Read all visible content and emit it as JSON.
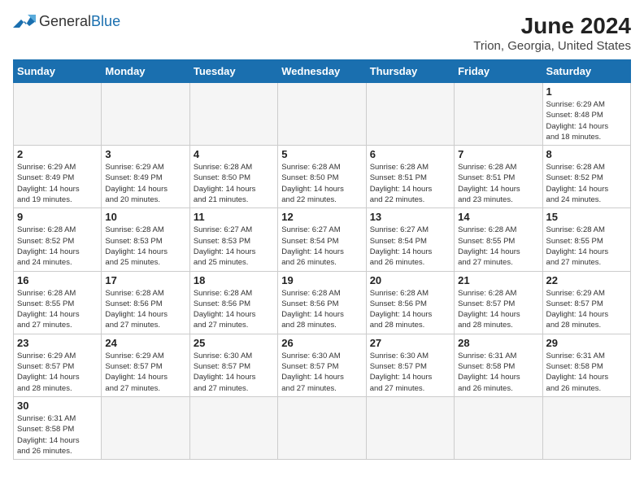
{
  "logo": {
    "text_general": "General",
    "text_blue": "Blue"
  },
  "title": "June 2024",
  "subtitle": "Trion, Georgia, United States",
  "days_of_week": [
    "Sunday",
    "Monday",
    "Tuesday",
    "Wednesday",
    "Thursday",
    "Friday",
    "Saturday"
  ],
  "weeks": [
    [
      {
        "day": "",
        "info": ""
      },
      {
        "day": "",
        "info": ""
      },
      {
        "day": "",
        "info": ""
      },
      {
        "day": "",
        "info": ""
      },
      {
        "day": "",
        "info": ""
      },
      {
        "day": "",
        "info": ""
      },
      {
        "day": "1",
        "info": "Sunrise: 6:29 AM\nSunset: 8:48 PM\nDaylight: 14 hours\nand 18 minutes."
      }
    ],
    [
      {
        "day": "2",
        "info": "Sunrise: 6:29 AM\nSunset: 8:49 PM\nDaylight: 14 hours\nand 19 minutes."
      },
      {
        "day": "3",
        "info": "Sunrise: 6:29 AM\nSunset: 8:49 PM\nDaylight: 14 hours\nand 20 minutes."
      },
      {
        "day": "4",
        "info": "Sunrise: 6:28 AM\nSunset: 8:50 PM\nDaylight: 14 hours\nand 21 minutes."
      },
      {
        "day": "5",
        "info": "Sunrise: 6:28 AM\nSunset: 8:50 PM\nDaylight: 14 hours\nand 22 minutes."
      },
      {
        "day": "6",
        "info": "Sunrise: 6:28 AM\nSunset: 8:51 PM\nDaylight: 14 hours\nand 22 minutes."
      },
      {
        "day": "7",
        "info": "Sunrise: 6:28 AM\nSunset: 8:51 PM\nDaylight: 14 hours\nand 23 minutes."
      },
      {
        "day": "8",
        "info": "Sunrise: 6:28 AM\nSunset: 8:52 PM\nDaylight: 14 hours\nand 24 minutes."
      }
    ],
    [
      {
        "day": "9",
        "info": "Sunrise: 6:28 AM\nSunset: 8:52 PM\nDaylight: 14 hours\nand 24 minutes."
      },
      {
        "day": "10",
        "info": "Sunrise: 6:28 AM\nSunset: 8:53 PM\nDaylight: 14 hours\nand 25 minutes."
      },
      {
        "day": "11",
        "info": "Sunrise: 6:27 AM\nSunset: 8:53 PM\nDaylight: 14 hours\nand 25 minutes."
      },
      {
        "day": "12",
        "info": "Sunrise: 6:27 AM\nSunset: 8:54 PM\nDaylight: 14 hours\nand 26 minutes."
      },
      {
        "day": "13",
        "info": "Sunrise: 6:27 AM\nSunset: 8:54 PM\nDaylight: 14 hours\nand 26 minutes."
      },
      {
        "day": "14",
        "info": "Sunrise: 6:28 AM\nSunset: 8:55 PM\nDaylight: 14 hours\nand 27 minutes."
      },
      {
        "day": "15",
        "info": "Sunrise: 6:28 AM\nSunset: 8:55 PM\nDaylight: 14 hours\nand 27 minutes."
      }
    ],
    [
      {
        "day": "16",
        "info": "Sunrise: 6:28 AM\nSunset: 8:55 PM\nDaylight: 14 hours\nand 27 minutes."
      },
      {
        "day": "17",
        "info": "Sunrise: 6:28 AM\nSunset: 8:56 PM\nDaylight: 14 hours\nand 27 minutes."
      },
      {
        "day": "18",
        "info": "Sunrise: 6:28 AM\nSunset: 8:56 PM\nDaylight: 14 hours\nand 27 minutes."
      },
      {
        "day": "19",
        "info": "Sunrise: 6:28 AM\nSunset: 8:56 PM\nDaylight: 14 hours\nand 28 minutes."
      },
      {
        "day": "20",
        "info": "Sunrise: 6:28 AM\nSunset: 8:56 PM\nDaylight: 14 hours\nand 28 minutes."
      },
      {
        "day": "21",
        "info": "Sunrise: 6:28 AM\nSunset: 8:57 PM\nDaylight: 14 hours\nand 28 minutes."
      },
      {
        "day": "22",
        "info": "Sunrise: 6:29 AM\nSunset: 8:57 PM\nDaylight: 14 hours\nand 28 minutes."
      }
    ],
    [
      {
        "day": "23",
        "info": "Sunrise: 6:29 AM\nSunset: 8:57 PM\nDaylight: 14 hours\nand 28 minutes."
      },
      {
        "day": "24",
        "info": "Sunrise: 6:29 AM\nSunset: 8:57 PM\nDaylight: 14 hours\nand 27 minutes."
      },
      {
        "day": "25",
        "info": "Sunrise: 6:30 AM\nSunset: 8:57 PM\nDaylight: 14 hours\nand 27 minutes."
      },
      {
        "day": "26",
        "info": "Sunrise: 6:30 AM\nSunset: 8:57 PM\nDaylight: 14 hours\nand 27 minutes."
      },
      {
        "day": "27",
        "info": "Sunrise: 6:30 AM\nSunset: 8:57 PM\nDaylight: 14 hours\nand 27 minutes."
      },
      {
        "day": "28",
        "info": "Sunrise: 6:31 AM\nSunset: 8:58 PM\nDaylight: 14 hours\nand 26 minutes."
      },
      {
        "day": "29",
        "info": "Sunrise: 6:31 AM\nSunset: 8:58 PM\nDaylight: 14 hours\nand 26 minutes."
      }
    ],
    [
      {
        "day": "30",
        "info": "Sunrise: 6:31 AM\nSunset: 8:58 PM\nDaylight: 14 hours\nand 26 minutes."
      },
      {
        "day": "",
        "info": ""
      },
      {
        "day": "",
        "info": ""
      },
      {
        "day": "",
        "info": ""
      },
      {
        "day": "",
        "info": ""
      },
      {
        "day": "",
        "info": ""
      },
      {
        "day": "",
        "info": ""
      }
    ]
  ]
}
